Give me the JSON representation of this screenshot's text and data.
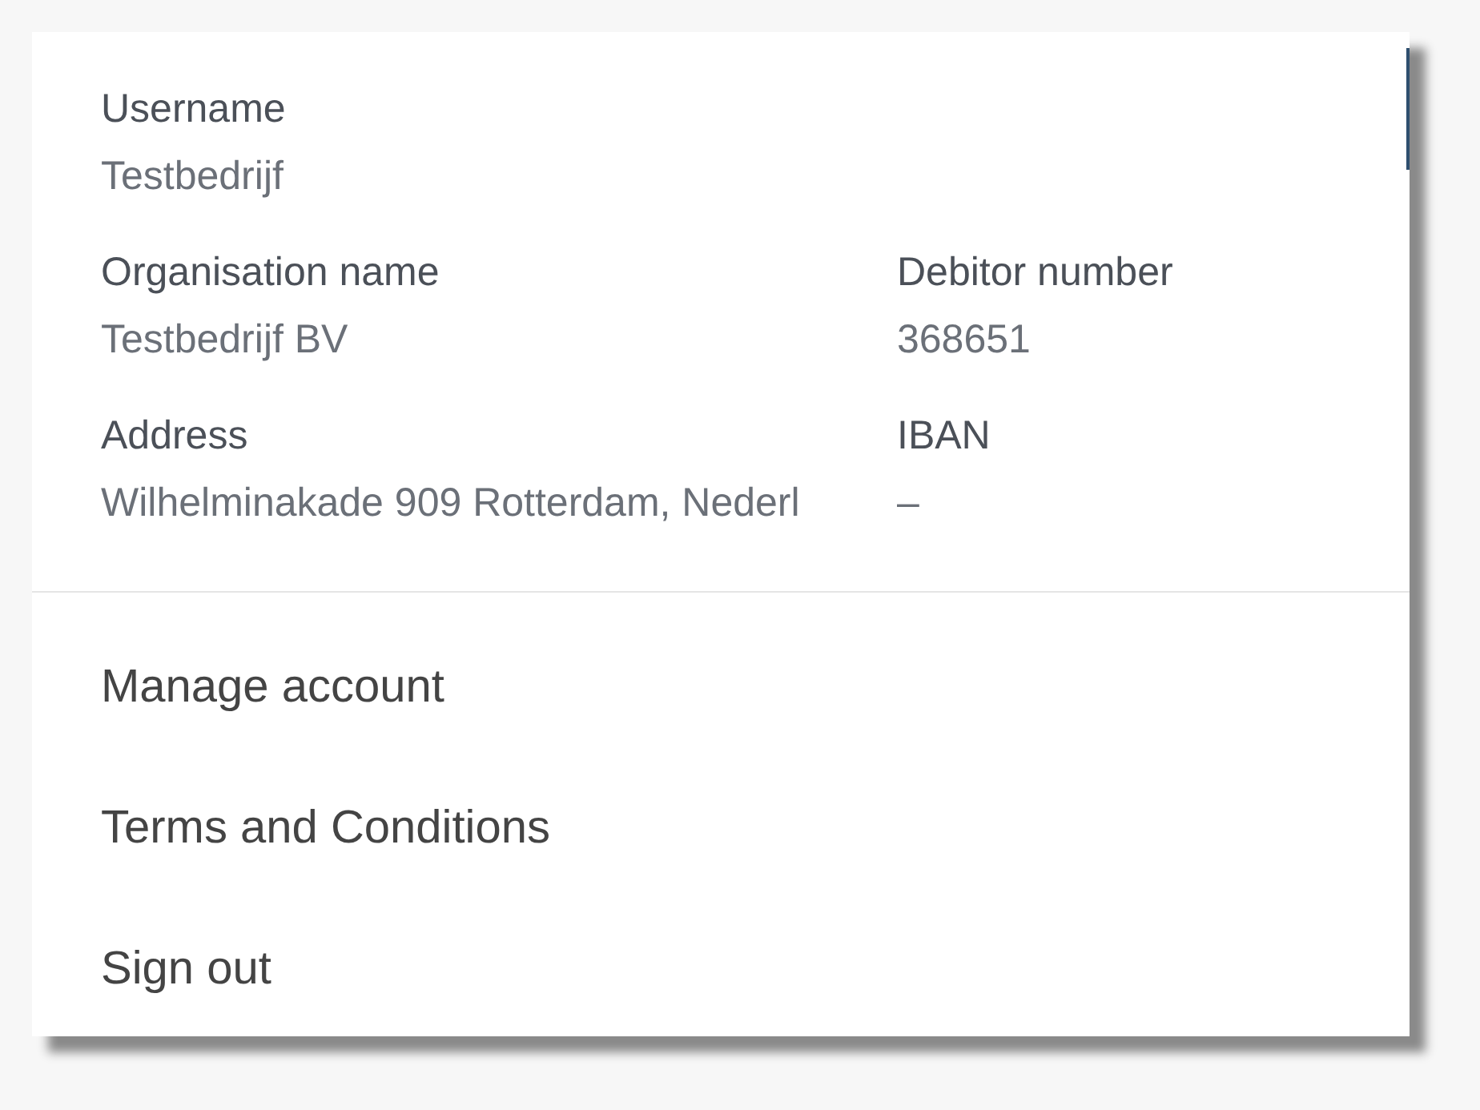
{
  "account": {
    "fields": [
      {
        "label": "Username",
        "value": "Testbedrijf"
      },
      {
        "label": "Organisation name",
        "value": "Testbedrijf BV"
      },
      {
        "label": "Debitor number",
        "value": "368651"
      },
      {
        "label": "Address",
        "value": "Wilhelminakade 909 Rotterdam, Nederl"
      },
      {
        "label": "IBAN",
        "value": "–"
      }
    ]
  },
  "menu": [
    "Manage account",
    "Terms and Conditions",
    "Sign out"
  ]
}
